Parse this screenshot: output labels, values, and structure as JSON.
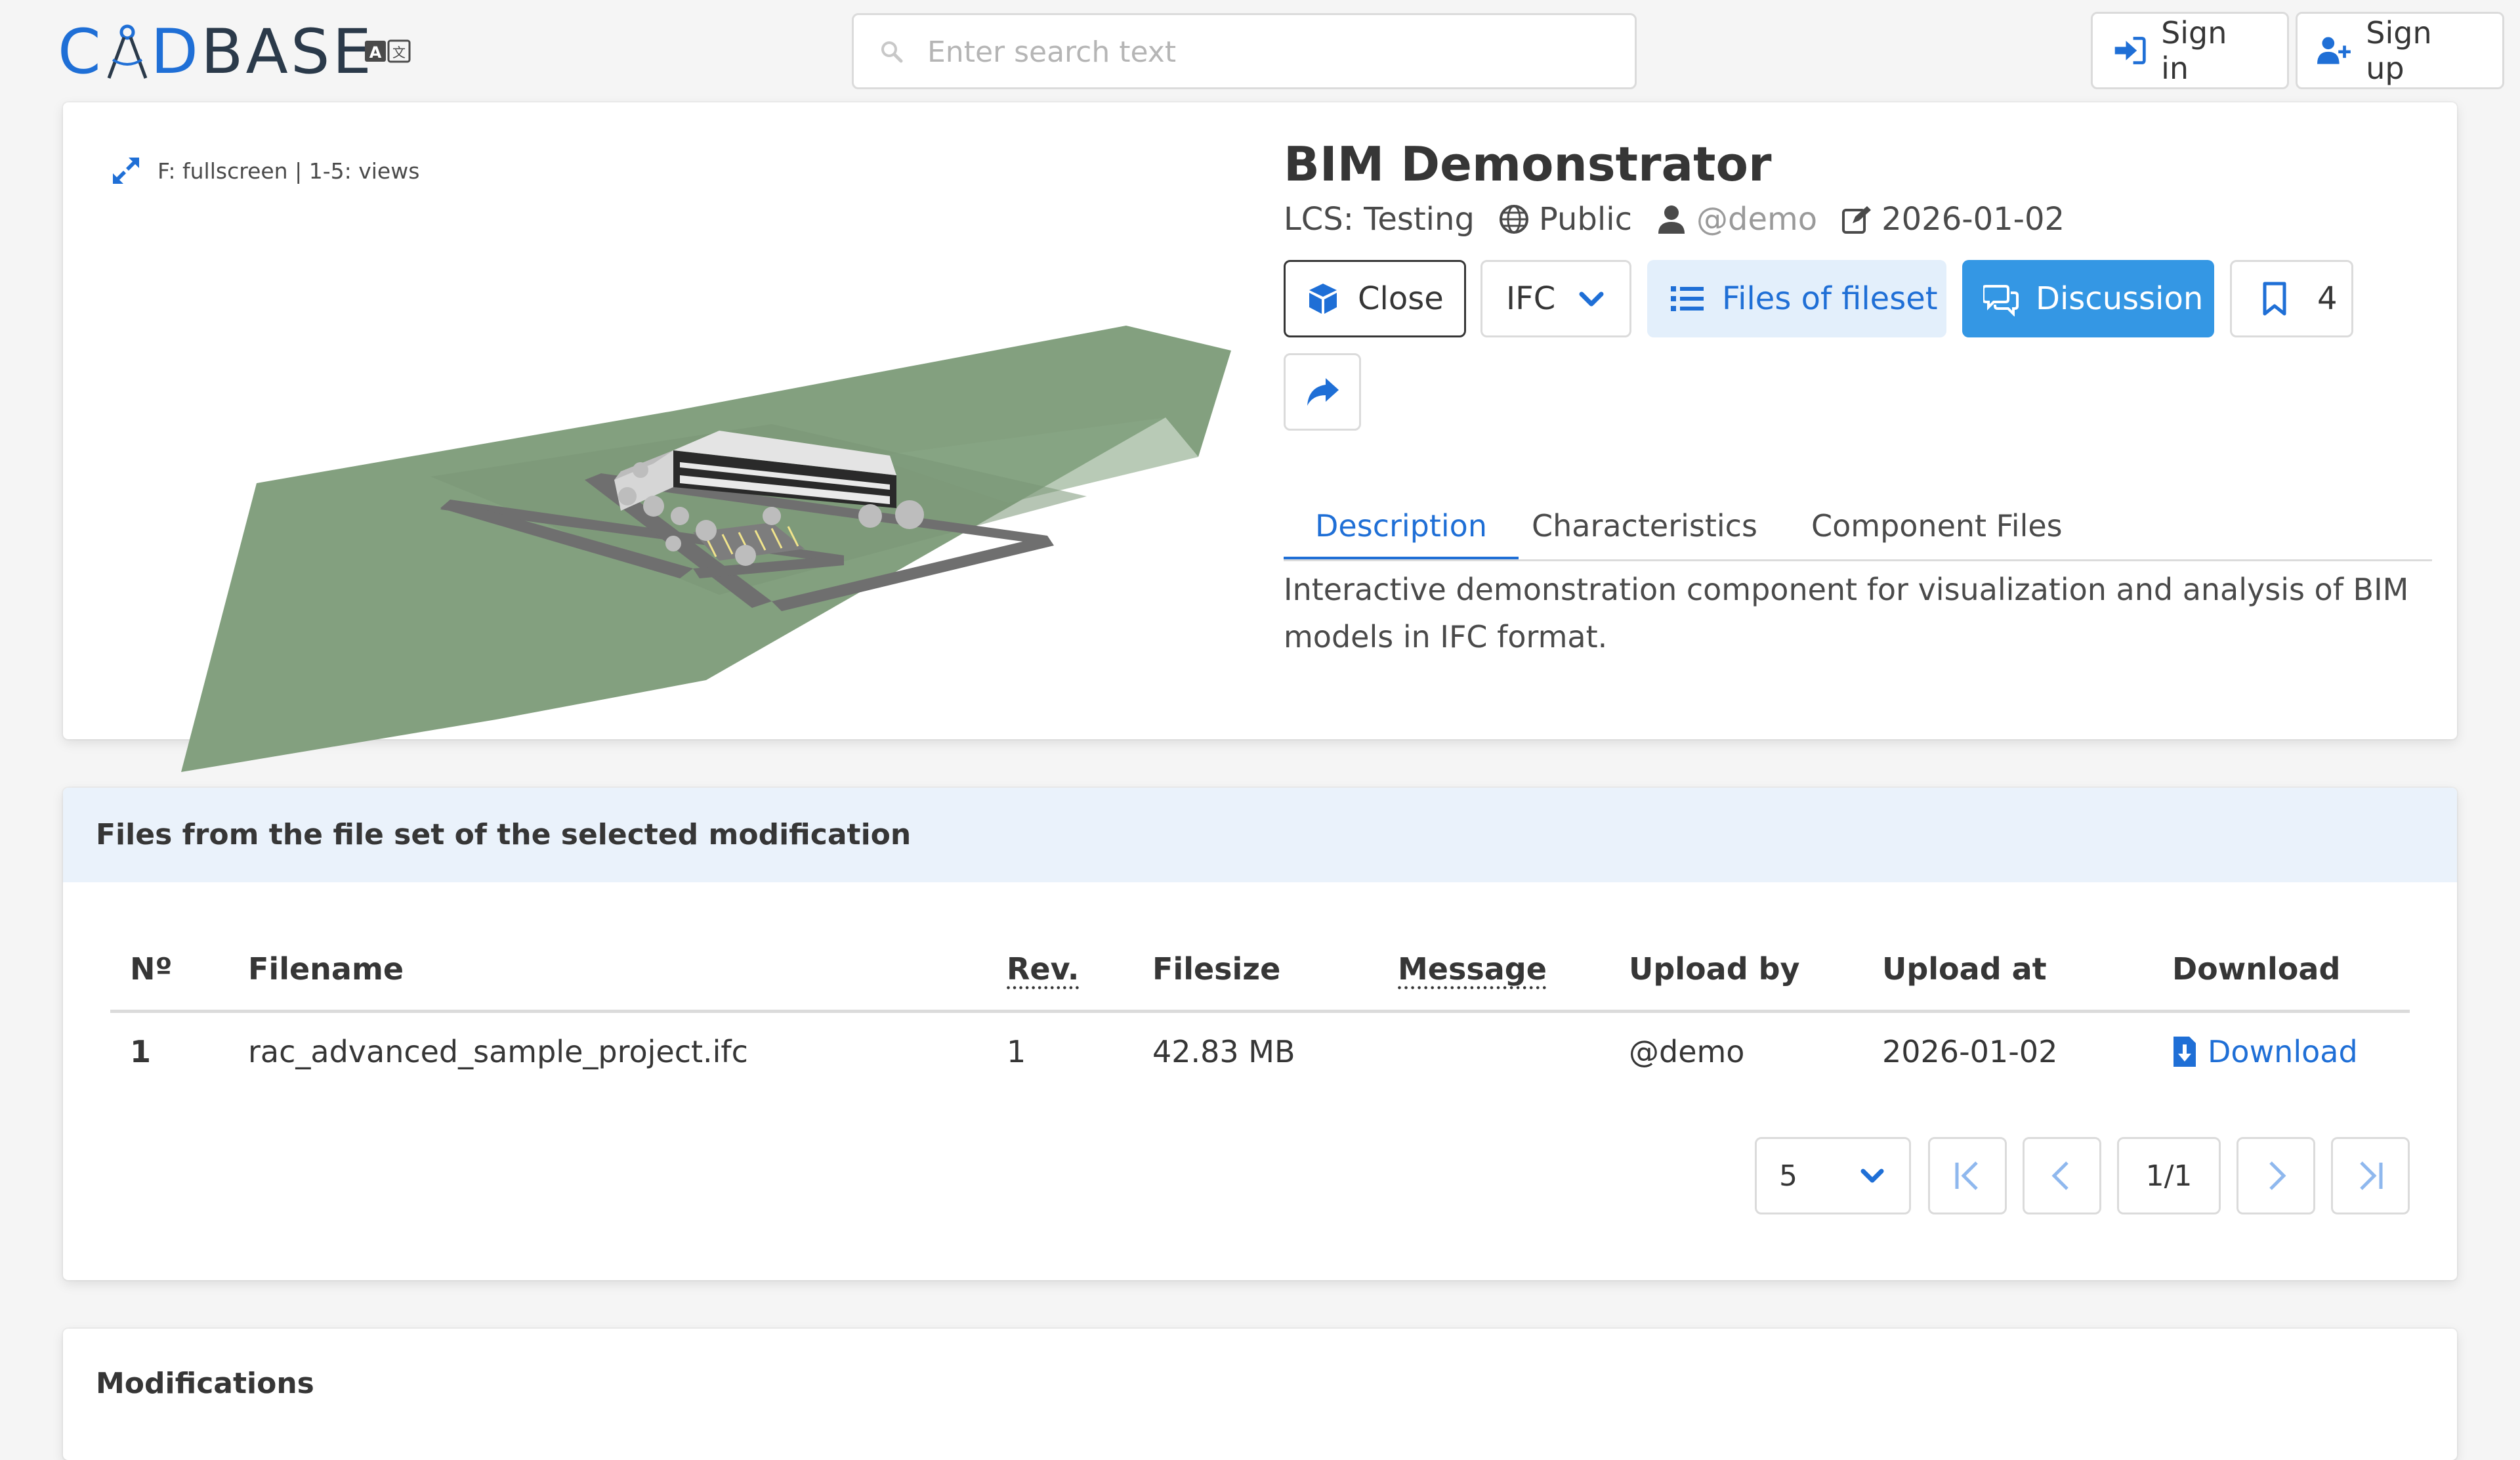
{
  "navbar": {
    "logo": {
      "part1": "C",
      "part2": "D",
      "part3": "BASE"
    },
    "search_placeholder": "Enter search text",
    "signin_label": "Sign in",
    "signup_label": "Sign up"
  },
  "viewer": {
    "hint": "F: fullscreen | 1-5: views"
  },
  "component": {
    "title": "BIM Demonstrator",
    "lcs": "LCS: Testing",
    "visibility": "Public",
    "owner": "@demo",
    "updated": "2026-01-02",
    "buttons": {
      "close": "Close",
      "format": "IFC",
      "files": "Files of fileset",
      "discussion": "Discussion",
      "bookmark_count": "4"
    },
    "tabs": [
      "Description",
      "Characteristics",
      "Component Files"
    ],
    "description": "Interactive demonstration component for visualization and analysis of BIM models in IFC format."
  },
  "files_panel": {
    "title": "Files from the file set of the selected modification",
    "columns": [
      "Nº",
      "Filename",
      "Rev.",
      "Filesize",
      "Message",
      "Upload by",
      "Upload at",
      "Download"
    ],
    "rows": [
      {
        "n": "1",
        "filename": "rac_advanced_sample_project.ifc",
        "rev": "1",
        "filesize": "42.83 MB",
        "message": "",
        "upload_by": "@demo",
        "upload_at": "2026-01-02",
        "download": "Download"
      }
    ],
    "pagination": {
      "per_page": "5",
      "page": "1/1"
    }
  },
  "modifications_panel": {
    "title": "Modifications"
  },
  "colors": {
    "accent": "#1f6fd6",
    "discussion_bg": "#3497e4",
    "files_bg": "#e3effb",
    "panel_header_bg": "#eaf2fb",
    "terrain": "#83a07f"
  },
  "icons": [
    "compass-logo-icon",
    "translate-icon",
    "search-icon",
    "sign-in-icon",
    "user-plus-icon",
    "expand-icon",
    "globe-icon",
    "user-icon",
    "edit-icon",
    "cube-icon",
    "chevron-down-icon",
    "list-icon",
    "comments-icon",
    "bookmark-icon",
    "share-icon",
    "file-download-icon",
    "first-page-icon",
    "prev-page-icon",
    "next-page-icon",
    "last-page-icon"
  ]
}
